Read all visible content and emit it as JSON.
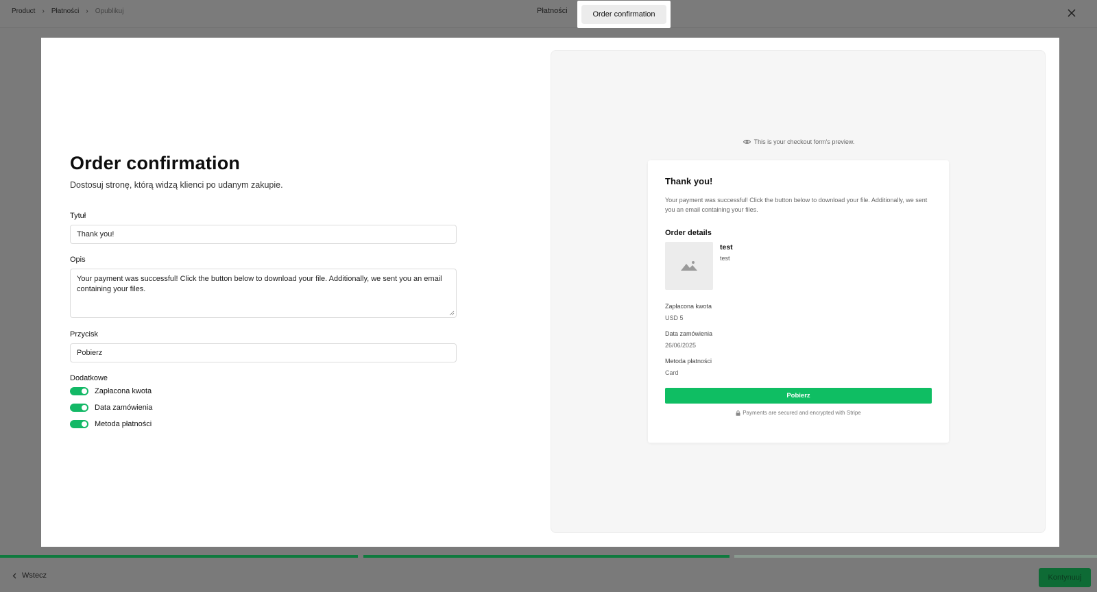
{
  "breadcrumb": [
    "Product",
    "Płatności",
    "Opublikuj"
  ],
  "header": {
    "step_title": "Płatności",
    "step_chip": "Order confirmation"
  },
  "form": {
    "title": "Order confirmation",
    "subtitle": "Dostosuj stronę, którą widzą klienci po udanym zakupie.",
    "title_label": "Tytuł",
    "title_value": "Thank you!",
    "desc_label": "Opis",
    "desc_value": "Your payment was successful! Click the button below to download your file. Additionally, we sent you an email containing your files.",
    "button_label": "Przycisk",
    "button_value": "Pobierz",
    "extras_label": "Dodatkowe",
    "toggles": [
      {
        "label": "Zapłacona kwota",
        "on": true
      },
      {
        "label": "Data zamówienia",
        "on": true
      },
      {
        "label": "Metoda płatności",
        "on": true
      }
    ]
  },
  "preview": {
    "note": "This is your checkout form's preview.",
    "card_title": "Thank you!",
    "card_desc": "Your payment was successful! Click the button below to download your file. Additionally, we sent you an email containing your files.",
    "order_details": "Order details",
    "item_name": "test",
    "item_sub": "test",
    "meta": [
      {
        "label": "Zapłacona kwota",
        "value": "USD 5"
      },
      {
        "label": "Data zamówienia",
        "value": "26/06/2025"
      },
      {
        "label": "Metoda płatności",
        "value": "Card"
      }
    ],
    "pay_button": "Pobierz",
    "secure_note": "Payments are secured and encrypted with Stripe"
  },
  "footer": {
    "back_label": "Wstecz",
    "next_label": "Kontynuuj"
  },
  "colors": {
    "accent": "#0fbe63",
    "toggle": "#13b866",
    "progress_done": "#0f7a3e"
  }
}
